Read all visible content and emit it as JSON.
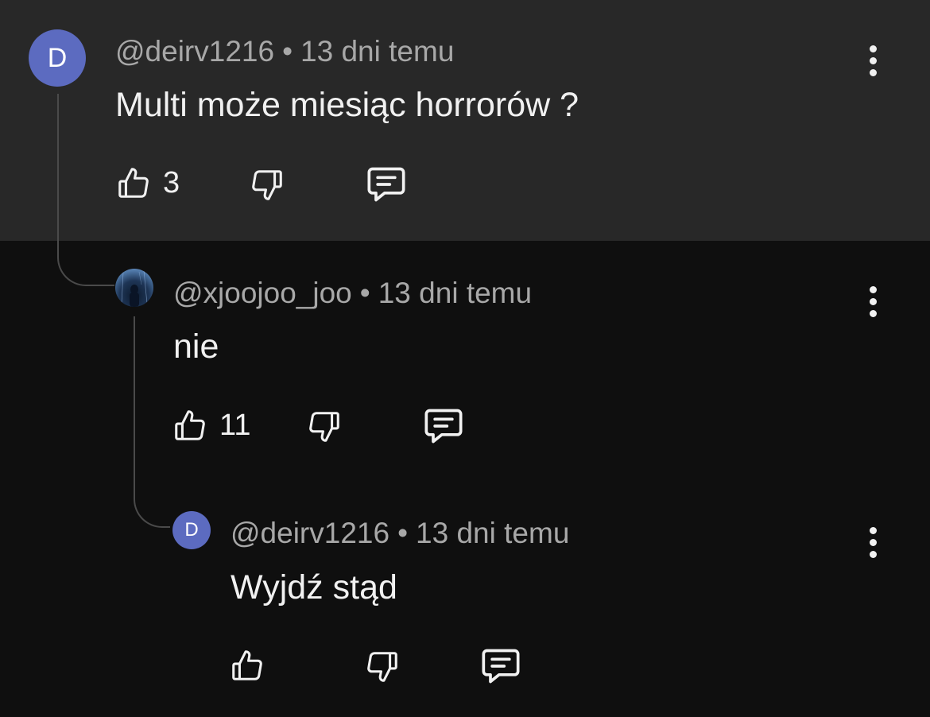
{
  "comments": [
    {
      "author": "@deirv1216",
      "separator": "•",
      "time": "13 dni temu",
      "avatar_letter": "D",
      "text": "Multi może miesiąc horrorów ?",
      "likes": "3"
    },
    {
      "author": "@xjoojoo_joo",
      "separator": "•",
      "time": "13 dni temu",
      "avatar_letter": "",
      "text": "nie",
      "likes": "11"
    },
    {
      "author": "@deirv1216",
      "separator": "•",
      "time": "13 dni temu",
      "avatar_letter": "D",
      "text": "Wyjdź stąd",
      "likes": ""
    }
  ],
  "icons": {
    "like": "thumbs-up-icon",
    "dislike": "thumbs-down-icon",
    "reply": "reply-icon",
    "more": "more-vertical-icon"
  },
  "colors": {
    "top_panel": "#282828",
    "background": "#0f0f0f",
    "avatar_letter_bg": "#5c6bc0",
    "meta_text": "#a8a8a8",
    "primary_text": "#f1f1f1"
  }
}
